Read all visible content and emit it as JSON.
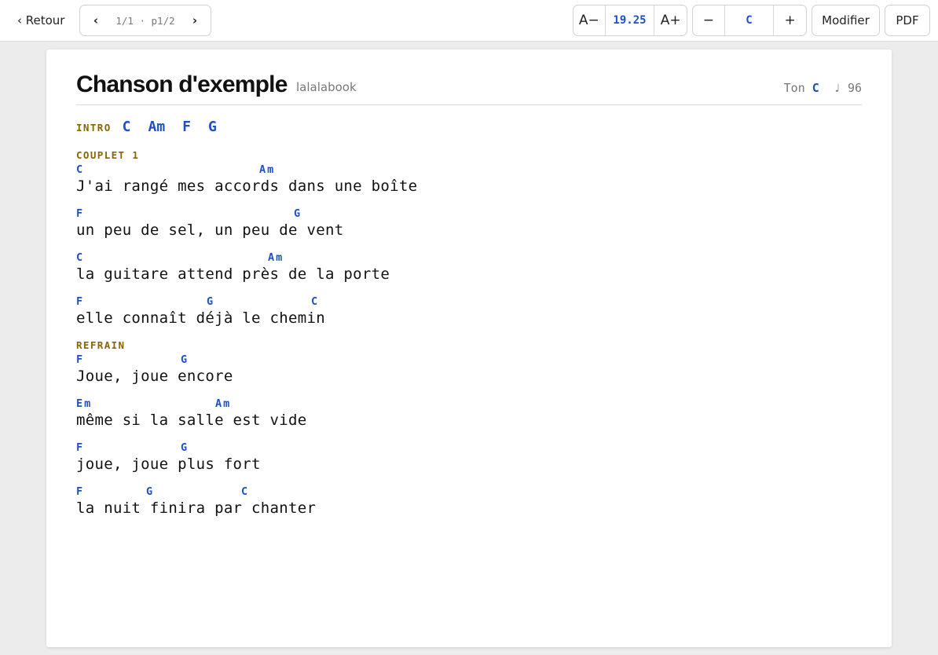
{
  "toolbar": {
    "back_label": "‹ Retour",
    "prev_icon": "chevron-left-icon",
    "next_icon": "chevron-right-icon",
    "prev_glyph": "‹",
    "next_glyph": "›",
    "page_indicator": "1/1 · p1/2",
    "font_decrease_label": "A−",
    "font_size_value": "19.25",
    "font_increase_label": "A+",
    "transpose_down_label": "−",
    "transpose_key": "C",
    "transpose_up_label": "+",
    "edit_label": "Modifier",
    "pdf_label": "PDF"
  },
  "song": {
    "title": "Chanson d'exemple",
    "artist": "lalalabook",
    "key_label": "Ton",
    "key_value": "C",
    "tempo_symbol": "♩",
    "tempo_value": "96"
  },
  "intro": {
    "label": "INTRO",
    "chords": [
      "C",
      "Am",
      "F",
      "G"
    ]
  },
  "verse1": {
    "label": "COUPLET 1",
    "lines": [
      {
        "lyric": "J'ai rangé mes accords dans une boîte",
        "chords": [
          "C",
          "Am"
        ]
      },
      {
        "lyric": "un peu de sel, un peu de vent",
        "chords": [
          "F",
          "G"
        ]
      },
      {
        "lyric": "la guitare attend près de la porte",
        "chords": [
          "C",
          "Am"
        ]
      },
      {
        "lyric": "elle connaît déjà le chemin",
        "chords": [
          "F",
          "G",
          "C"
        ]
      }
    ]
  },
  "chorus": {
    "label": "REFRAIN",
    "lines": [
      {
        "lyric": "Joue, joue encore",
        "chords": [
          "F",
          "G"
        ]
      },
      {
        "lyric": "même si la salle est vide",
        "chords": [
          "Em",
          "Am"
        ]
      },
      {
        "lyric": "joue, joue plus fort",
        "chords": [
          "F",
          "G"
        ]
      },
      {
        "lyric": "la nuit finira par chanter",
        "chords": [
          "F",
          "G",
          "C"
        ]
      }
    ]
  },
  "colors": {
    "chord": "#1f4fc8",
    "section_label": "#8a6400",
    "background": "#ececec"
  }
}
